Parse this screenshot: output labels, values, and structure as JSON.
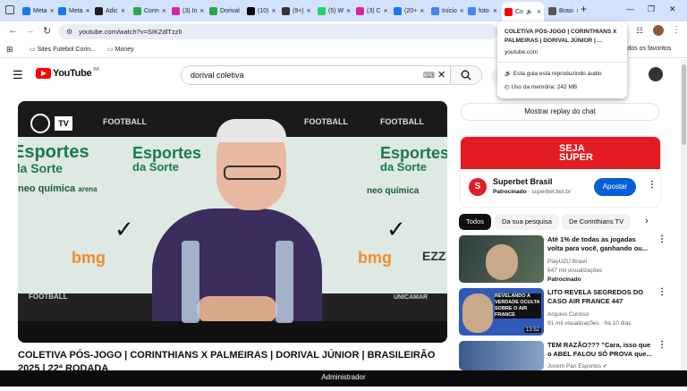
{
  "tabs": [
    {
      "label": "Meta",
      "color": "#1877f2",
      "icon": "meta-icon"
    },
    {
      "label": "Meta",
      "color": "#1877f2",
      "icon": "meta-icon"
    },
    {
      "label": "Adic",
      "color": "#202020",
      "icon": "threads-icon"
    },
    {
      "label": "Corin",
      "color": "#2da44e",
      "icon": "site-icon"
    },
    {
      "label": "(3) In",
      "color": "#d6249f",
      "icon": "instagram-icon"
    },
    {
      "label": "Dorival",
      "color": "#2da44e",
      "icon": "site-icon"
    },
    {
      "label": "(10)",
      "color": "#000000",
      "icon": "x-icon"
    },
    {
      "label": "(9+)",
      "color": "#333333",
      "icon": "threads-icon"
    },
    {
      "label": "(5) W",
      "color": "#25d366",
      "icon": "whatsapp-icon"
    },
    {
      "label": "(3) C",
      "color": "#d6249f",
      "icon": "instagram-icon"
    },
    {
      "label": "(20+",
      "color": "#1877f2",
      "icon": "facebook-icon"
    },
    {
      "label": "Início",
      "color": "#4285f4",
      "icon": "google-icon"
    },
    {
      "label": "foto",
      "color": "#4285f4",
      "icon": "google-icon"
    },
    {
      "label": "Co",
      "color": "#ff0000",
      "icon": "youtube-icon",
      "active": true
    },
    {
      "label": "Brasi",
      "color": "#555555",
      "icon": "site-icon"
    }
  ],
  "toolbar": {
    "url": "youtube.com/watch?v=SIKZdlTzzlI"
  },
  "bookmarks": {
    "item1": "Sites Futebol Corin...",
    "item2": "Money",
    "all": "Todos os favoritos"
  },
  "hovercard": {
    "title": "COLETIVA PÓS-JOGO | CORINTHIANS X PALMEIRAS | DORIVAL JÚNIOR | ...",
    "domain": "youtube.com",
    "audio": "Esta guia está reproduzindo áudio",
    "memory": "Uso da memória: 242 MB"
  },
  "youtube": {
    "logo": "YouTube",
    "region": "BR",
    "search_value": "dorival coletiva"
  },
  "player": {
    "sponsor1": "Esportes",
    "sponsor1b": "da Sorte",
    "sponsor2": "neo química",
    "sponsor2b": "arena",
    "brand_bmg": "bmg",
    "brand_football": "FOOTBALL",
    "brand_ezz": "EZZ",
    "brand_uni": "UNICAMAR"
  },
  "video": {
    "title": "COLETIVA PÓS-JOGO | CORINTHIANS X PALMEIRAS | DORIVAL JÚNIOR | BRASILEIRÃO 2025 | 22ª RODADA"
  },
  "chat": {
    "replay_label": "Mostrar replay do chat"
  },
  "ad": {
    "name": "Superbet Brasil",
    "sponsored": "Patrocinado",
    "domain": "· superbet.bet.br",
    "cta": "Apostar",
    "banner_text": "SEJA SUPER"
  },
  "chips": [
    "Todos",
    "Da sua pesquisa",
    "De Corinthians TV"
  ],
  "recs": [
    {
      "title": "Até 1% de todas as jogadas volta para você, ganhando ou...",
      "channel": "PlayUZU Brasil",
      "meta": "647 mil visualizações",
      "extra": "Patrocinado"
    },
    {
      "title": "LITO REVELA SEGREDOS DO CASO AIR FRANCE 447",
      "channel": "Arquivo Curioso",
      "meta": "91 mil visualizações · há 10 dias",
      "duration": "13:52",
      "thumb_text": "REVELANDO A VERDADE OCULTA SOBRE O AIR FRANCE"
    },
    {
      "title": "TEM RAZÃO??? \"Cara, isso que o ABEL FALOU SÓ PROVA que...",
      "channel": "Jovem Pan Esportes"
    }
  ],
  "taskbar": {
    "label": "Administrador"
  }
}
